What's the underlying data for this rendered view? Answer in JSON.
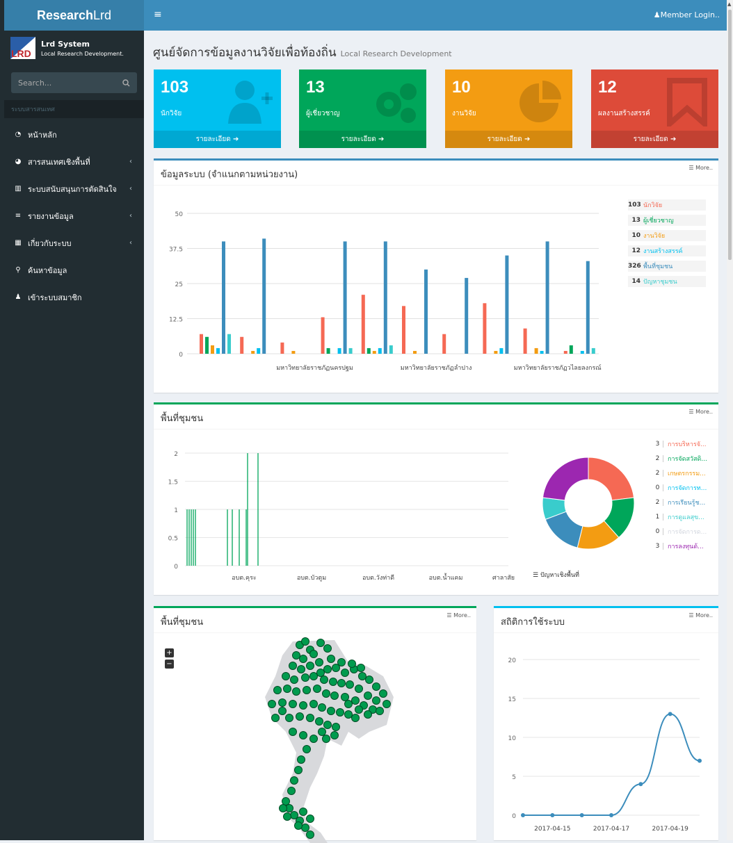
{
  "app": {
    "logo_bold": "Research",
    "logo_light": "Lrd",
    "system_name": "Lrd System",
    "system_sub": "Local Research Development.",
    "member_login": "Member Login.."
  },
  "search": {
    "placeholder": "Search..."
  },
  "sidebar": {
    "header": "ระบบสารสนเทศ",
    "items": [
      {
        "label": "หน้าหลัก",
        "icon": "dashboard-icon",
        "arrow": false
      },
      {
        "label": "สารสนเทศเชิงพื้นที่",
        "icon": "pie-chart-icon",
        "arrow": true
      },
      {
        "label": "ระบบสนับสนุนการตัดสินใจ",
        "icon": "bar-chart-icon",
        "arrow": true
      },
      {
        "label": "รายงานข้อมูล",
        "icon": "list-icon",
        "arrow": true
      },
      {
        "label": "เกี่ยวกับระบบ",
        "icon": "grid-icon",
        "arrow": true
      },
      {
        "label": "ค้นหาข้อมูล",
        "icon": "search-icon",
        "arrow": false
      },
      {
        "label": "เข้าระบบสมาชิก",
        "icon": "user-icon",
        "arrow": false
      }
    ]
  },
  "page": {
    "title": "ศูนย์จัดการข้อมูลงานวิจัยเพื่อท้องถิ่น",
    "subtitle": "Local Research Development"
  },
  "tiles": [
    {
      "num": "103",
      "label": "นักวิจัย",
      "footer": "รายละเอียด",
      "color": "#00c0ef",
      "icon": "user-plus-icon"
    },
    {
      "num": "13",
      "label": "ผู้เชี่ยวชาญ",
      "footer": "รายละเอียด",
      "color": "#00a65a",
      "icon": "gears-icon"
    },
    {
      "num": "10",
      "label": "งานวิจัย",
      "footer": "รายละเอียด",
      "color": "#f39c12",
      "icon": "pie-chart-icon"
    },
    {
      "num": "12",
      "label": "ผลงานสร้างสรรค์",
      "footer": "รายละเอียด",
      "color": "#dd4b39",
      "icon": "bookmark-icon"
    }
  ],
  "more_label": "More..",
  "box1": {
    "title": "ข้อมูลระบบ (จำแนกตามหน่วยงาน)",
    "legend": [
      {
        "n": "103",
        "label": "นักวิจัย",
        "color": "#f56954"
      },
      {
        "n": "13",
        "label": "ผู้เชี่ยวชาญ",
        "color": "#00a65a"
      },
      {
        "n": "10",
        "label": "งานวิจัย",
        "color": "#f39c12"
      },
      {
        "n": "12",
        "label": "งานสร้างสรรค์",
        "color": "#00c0ef"
      },
      {
        "n": "326",
        "label": "พื้นที่ชุมชน",
        "color": "#3c8dbc"
      },
      {
        "n": "14",
        "label": "ปัญหาชุมชน",
        "color": "#39cccc"
      }
    ]
  },
  "box2": {
    "title": "พื้นที่ชุมชน",
    "donut_label": "ปัญหาเชิงพื้นที่",
    "legend": [
      {
        "n": "3",
        "label": "การบริหารจั...",
        "color": "#f56954"
      },
      {
        "n": "2",
        "label": "การจัดสวัสดิ...",
        "color": "#00a65a"
      },
      {
        "n": "2",
        "label": "เกษตรกรรม...",
        "color": "#f39c12"
      },
      {
        "n": "0",
        "label": "การจัดการท...",
        "color": "#00c0ef"
      },
      {
        "n": "2",
        "label": "การเรียนรู้ช...",
        "color": "#3c8dbc"
      },
      {
        "n": "1",
        "label": "การดูแลสุข...",
        "color": "#39cccc"
      },
      {
        "n": "0",
        "label": "การจัดการด...",
        "color": "#d2d6de"
      },
      {
        "n": "3",
        "label": "การลงทุนด้...",
        "color": "#9c27b0"
      }
    ]
  },
  "box3": {
    "title": "พื้นที่ชุมชน",
    "zoom_in": "+",
    "zoom_out": "−"
  },
  "box4": {
    "title": "สถิติการใช้ระบบ"
  },
  "chart_data": [
    {
      "type": "bar",
      "title": "ข้อมูลระบบ (จำแนกตามหน่วยงาน)",
      "categories": [
        "",
        "",
        "มหาวิทยาลัยราชภัฏนครปฐม",
        "",
        "",
        "มหาวิทยาลัยราชภัฏลำปาง",
        "",
        "",
        "มหาวิทยาลัยราชภัฏวไลยลงกรณ์",
        ""
      ],
      "series": [
        {
          "name": "นักวิจัย",
          "color": "#f56954",
          "values": [
            7,
            6,
            4,
            13,
            21,
            17,
            7,
            18,
            9,
            1
          ]
        },
        {
          "name": "ผู้เชี่ยวชาญ",
          "color": "#00a65a",
          "values": [
            6,
            0,
            0,
            2,
            2,
            0,
            0,
            0,
            0,
            3
          ]
        },
        {
          "name": "งานวิจัย",
          "color": "#f39c12",
          "values": [
            3,
            1,
            1,
            0,
            1,
            1,
            0,
            1,
            2,
            0
          ]
        },
        {
          "name": "งานสร้างสรรค์",
          "color": "#00c0ef",
          "values": [
            2,
            2,
            0,
            2,
            2,
            0,
            0,
            2,
            1,
            1
          ]
        },
        {
          "name": "พื้นที่ชุมชน",
          "color": "#3c8dbc",
          "values": [
            40,
            41,
            0,
            40,
            40,
            30,
            27,
            35,
            40,
            33
          ]
        },
        {
          "name": "ปัญหาชุมชน",
          "color": "#39cccc",
          "values": [
            7,
            0,
            0,
            2,
            3,
            0,
            0,
            0,
            0,
            2
          ]
        }
      ],
      "yticks": [
        "0",
        "12.5",
        "25",
        "37.5",
        "50"
      ],
      "ylim": [
        0,
        50
      ]
    },
    {
      "type": "bar",
      "title": "พื้นที่ชุมชน",
      "categories": [
        "อบต.คุระ",
        "อบต.บัวตูม",
        "อบต.วังท่าดี",
        "อบต.น้ำแคม",
        "ศาลาสัย"
      ],
      "values": [
        1,
        1,
        1,
        1,
        1,
        1,
        1,
        1,
        1,
        2,
        2
      ],
      "yticks": [
        "0",
        "0.5",
        "1",
        "1.5",
        "2"
      ],
      "ylim": [
        0,
        2
      ]
    },
    {
      "type": "pie",
      "title": "ปัญหาเชิงพื้นที่",
      "labels": [
        "การบริหารจั...",
        "การจัดสวัสดิ...",
        "เกษตรกรรม...",
        "การจัดการท...",
        "การเรียนรู้ช...",
        "การดูแลสุข...",
        "การจัดการด...",
        "การลงทุนด้..."
      ],
      "values": [
        3,
        2,
        2,
        0,
        2,
        1,
        0,
        3
      ]
    },
    {
      "type": "line",
      "title": "สถิติการใช้ระบบ",
      "x": [
        "2017-04-14",
        "2017-04-15",
        "2017-04-16",
        "2017-04-17",
        "2017-04-18",
        "2017-04-19",
        "2017-04-20"
      ],
      "xticks": [
        "2017-04-15",
        "2017-04-17",
        "2017-04-19"
      ],
      "values": [
        0,
        0,
        0,
        0,
        4,
        13,
        7
      ],
      "yticks": [
        "0",
        "5",
        "10",
        "15",
        "20"
      ],
      "ylim": [
        0,
        20
      ]
    }
  ]
}
